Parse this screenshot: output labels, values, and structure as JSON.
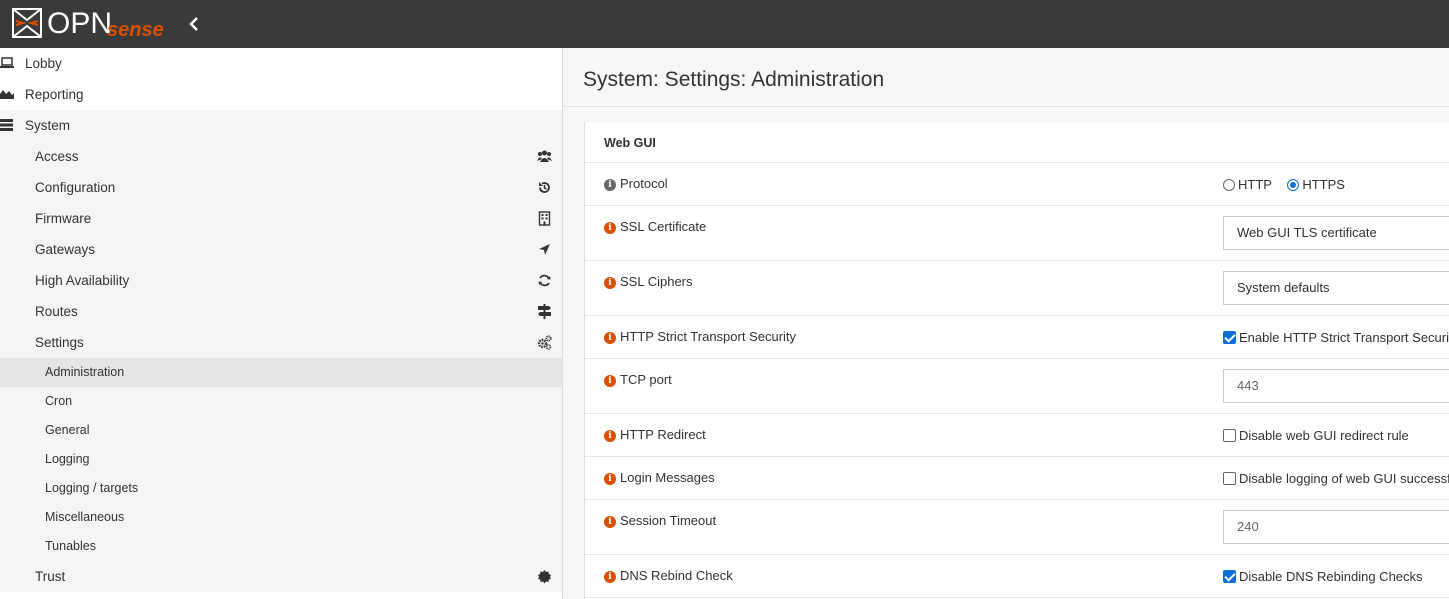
{
  "brand": {
    "logo_main": "OPN",
    "logo_accent": "sense",
    "accent_color": "#d94f00"
  },
  "sidebar": {
    "top_items": [
      {
        "label": "Lobby",
        "icon": "laptop-icon"
      },
      {
        "label": "Reporting",
        "icon": "area-chart-icon"
      },
      {
        "label": "System",
        "icon": "server-icon"
      }
    ],
    "system_items": [
      {
        "label": "Access",
        "icon": "users-icon"
      },
      {
        "label": "Configuration",
        "icon": "history-icon"
      },
      {
        "label": "Firmware",
        "icon": "building-icon"
      },
      {
        "label": "Gateways",
        "icon": "location-arrow-icon"
      },
      {
        "label": "High Availability",
        "icon": "refresh-icon"
      },
      {
        "label": "Routes",
        "icon": "map-signs-icon"
      },
      {
        "label": "Settings",
        "icon": "cogs-icon"
      }
    ],
    "settings_items": [
      "Administration",
      "Cron",
      "General",
      "Logging",
      "Logging / targets",
      "Miscellaneous",
      "Tunables"
    ],
    "active_settings_item": "Administration",
    "trust_item": {
      "label": "Trust",
      "icon": "certificate-icon"
    }
  },
  "main": {
    "title": "System: Settings: Administration",
    "section_title": "Web GUI",
    "rows": {
      "protocol": {
        "label": "Protocol",
        "options": [
          "HTTP",
          "HTTPS"
        ],
        "selected": "HTTPS"
      },
      "ssl_certificate": {
        "label": "SSL Certificate",
        "value": "Web GUI TLS certificate"
      },
      "ssl_ciphers": {
        "label": "SSL Ciphers",
        "value": "System defaults"
      },
      "hsts": {
        "label": "HTTP Strict Transport Security",
        "checkbox_label": "Enable HTTP Strict Transport Securi",
        "checked": true
      },
      "tcp_port": {
        "label": "TCP port",
        "placeholder": "443"
      },
      "http_redirect": {
        "label": "HTTP Redirect",
        "checkbox_label": "Disable web GUI redirect rule",
        "checked": false
      },
      "login_messages": {
        "label": "Login Messages",
        "checkbox_label": "Disable logging of web GUI successfu",
        "checked": false
      },
      "session_timeout": {
        "label": "Session Timeout",
        "placeholder": "240"
      },
      "dns_rebind": {
        "label": "DNS Rebind Check",
        "checkbox_label": "Disable DNS Rebinding Checks",
        "checked": true
      }
    }
  }
}
